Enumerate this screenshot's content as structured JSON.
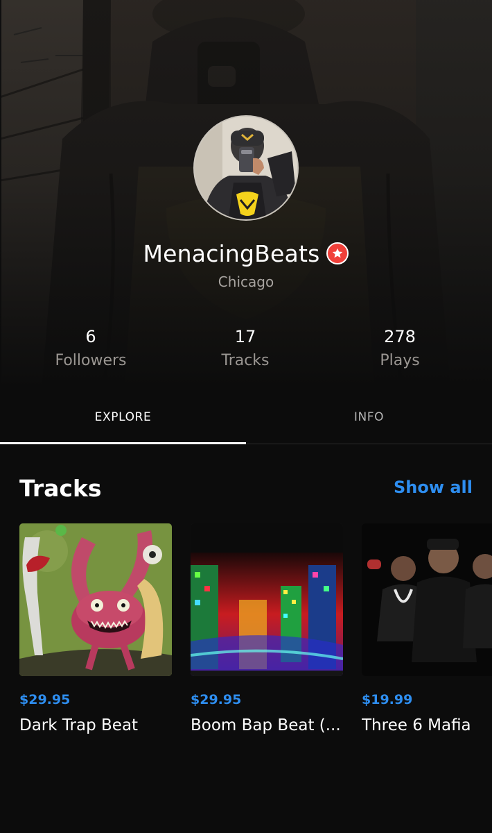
{
  "profile": {
    "username": "MenacingBeats",
    "location": "Chicago",
    "badge_icon": "star-badge-icon",
    "badge_color": "#f0403a"
  },
  "stats": [
    {
      "value": "6",
      "label": "Followers"
    },
    {
      "value": "17",
      "label": "Tracks"
    },
    {
      "value": "278",
      "label": "Plays"
    }
  ],
  "tabs": [
    {
      "label": "EXPLORE",
      "active": true
    },
    {
      "label": "INFO",
      "active": false
    }
  ],
  "tracks_section": {
    "title": "Tracks",
    "show_all_label": "Show all",
    "accent_color": "#2e8ef0",
    "items": [
      {
        "price": "$29.95",
        "title": "Dark Trap Beat"
      },
      {
        "price": "$29.95",
        "title": "Boom Bap Beat (..."
      },
      {
        "price": "$19.99",
        "title": "Three 6 Mafia"
      }
    ]
  }
}
